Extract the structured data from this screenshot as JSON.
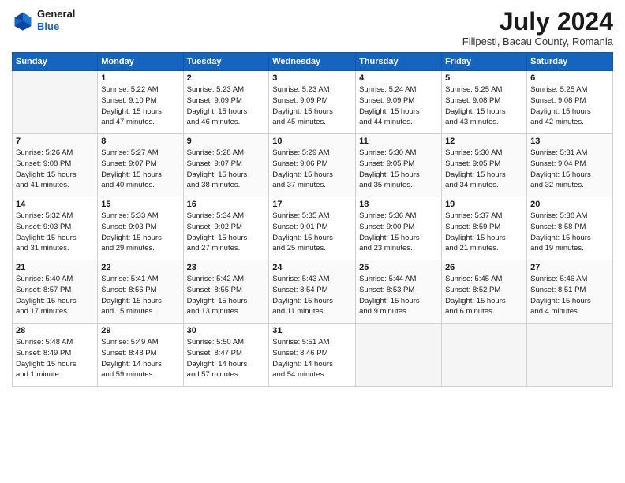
{
  "header": {
    "logo_line1": "General",
    "logo_line2": "Blue",
    "month_year": "July 2024",
    "location": "Filipesti, Bacau County, Romania"
  },
  "weekdays": [
    "Sunday",
    "Monday",
    "Tuesday",
    "Wednesday",
    "Thursday",
    "Friday",
    "Saturday"
  ],
  "weeks": [
    [
      {
        "day": "",
        "info": ""
      },
      {
        "day": "1",
        "info": "Sunrise: 5:22 AM\nSunset: 9:10 PM\nDaylight: 15 hours\nand 47 minutes."
      },
      {
        "day": "2",
        "info": "Sunrise: 5:23 AM\nSunset: 9:09 PM\nDaylight: 15 hours\nand 46 minutes."
      },
      {
        "day": "3",
        "info": "Sunrise: 5:23 AM\nSunset: 9:09 PM\nDaylight: 15 hours\nand 45 minutes."
      },
      {
        "day": "4",
        "info": "Sunrise: 5:24 AM\nSunset: 9:09 PM\nDaylight: 15 hours\nand 44 minutes."
      },
      {
        "day": "5",
        "info": "Sunrise: 5:25 AM\nSunset: 9:08 PM\nDaylight: 15 hours\nand 43 minutes."
      },
      {
        "day": "6",
        "info": "Sunrise: 5:25 AM\nSunset: 9:08 PM\nDaylight: 15 hours\nand 42 minutes."
      }
    ],
    [
      {
        "day": "7",
        "info": "Sunrise: 5:26 AM\nSunset: 9:08 PM\nDaylight: 15 hours\nand 41 minutes."
      },
      {
        "day": "8",
        "info": "Sunrise: 5:27 AM\nSunset: 9:07 PM\nDaylight: 15 hours\nand 40 minutes."
      },
      {
        "day": "9",
        "info": "Sunrise: 5:28 AM\nSunset: 9:07 PM\nDaylight: 15 hours\nand 38 minutes."
      },
      {
        "day": "10",
        "info": "Sunrise: 5:29 AM\nSunset: 9:06 PM\nDaylight: 15 hours\nand 37 minutes."
      },
      {
        "day": "11",
        "info": "Sunrise: 5:30 AM\nSunset: 9:05 PM\nDaylight: 15 hours\nand 35 minutes."
      },
      {
        "day": "12",
        "info": "Sunrise: 5:30 AM\nSunset: 9:05 PM\nDaylight: 15 hours\nand 34 minutes."
      },
      {
        "day": "13",
        "info": "Sunrise: 5:31 AM\nSunset: 9:04 PM\nDaylight: 15 hours\nand 32 minutes."
      }
    ],
    [
      {
        "day": "14",
        "info": "Sunrise: 5:32 AM\nSunset: 9:03 PM\nDaylight: 15 hours\nand 31 minutes."
      },
      {
        "day": "15",
        "info": "Sunrise: 5:33 AM\nSunset: 9:03 PM\nDaylight: 15 hours\nand 29 minutes."
      },
      {
        "day": "16",
        "info": "Sunrise: 5:34 AM\nSunset: 9:02 PM\nDaylight: 15 hours\nand 27 minutes."
      },
      {
        "day": "17",
        "info": "Sunrise: 5:35 AM\nSunset: 9:01 PM\nDaylight: 15 hours\nand 25 minutes."
      },
      {
        "day": "18",
        "info": "Sunrise: 5:36 AM\nSunset: 9:00 PM\nDaylight: 15 hours\nand 23 minutes."
      },
      {
        "day": "19",
        "info": "Sunrise: 5:37 AM\nSunset: 8:59 PM\nDaylight: 15 hours\nand 21 minutes."
      },
      {
        "day": "20",
        "info": "Sunrise: 5:38 AM\nSunset: 8:58 PM\nDaylight: 15 hours\nand 19 minutes."
      }
    ],
    [
      {
        "day": "21",
        "info": "Sunrise: 5:40 AM\nSunset: 8:57 PM\nDaylight: 15 hours\nand 17 minutes."
      },
      {
        "day": "22",
        "info": "Sunrise: 5:41 AM\nSunset: 8:56 PM\nDaylight: 15 hours\nand 15 minutes."
      },
      {
        "day": "23",
        "info": "Sunrise: 5:42 AM\nSunset: 8:55 PM\nDaylight: 15 hours\nand 13 minutes."
      },
      {
        "day": "24",
        "info": "Sunrise: 5:43 AM\nSunset: 8:54 PM\nDaylight: 15 hours\nand 11 minutes."
      },
      {
        "day": "25",
        "info": "Sunrise: 5:44 AM\nSunset: 8:53 PM\nDaylight: 15 hours\nand 9 minutes."
      },
      {
        "day": "26",
        "info": "Sunrise: 5:45 AM\nSunset: 8:52 PM\nDaylight: 15 hours\nand 6 minutes."
      },
      {
        "day": "27",
        "info": "Sunrise: 5:46 AM\nSunset: 8:51 PM\nDaylight: 15 hours\nand 4 minutes."
      }
    ],
    [
      {
        "day": "28",
        "info": "Sunrise: 5:48 AM\nSunset: 8:49 PM\nDaylight: 15 hours\nand 1 minute."
      },
      {
        "day": "29",
        "info": "Sunrise: 5:49 AM\nSunset: 8:48 PM\nDaylight: 14 hours\nand 59 minutes."
      },
      {
        "day": "30",
        "info": "Sunrise: 5:50 AM\nSunset: 8:47 PM\nDaylight: 14 hours\nand 57 minutes."
      },
      {
        "day": "31",
        "info": "Sunrise: 5:51 AM\nSunset: 8:46 PM\nDaylight: 14 hours\nand 54 minutes."
      },
      {
        "day": "",
        "info": ""
      },
      {
        "day": "",
        "info": ""
      },
      {
        "day": "",
        "info": ""
      }
    ]
  ]
}
